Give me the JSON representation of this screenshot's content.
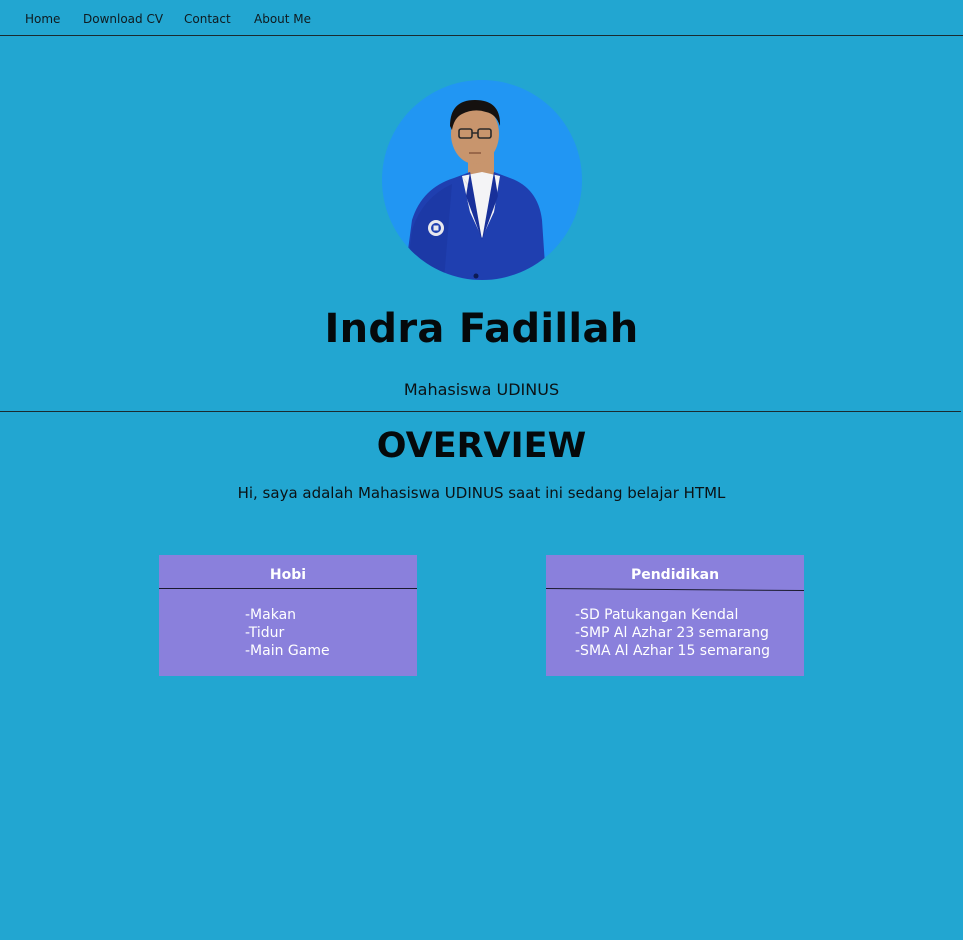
{
  "nav": {
    "items": [
      {
        "label": "Home"
      },
      {
        "label": "Download CV"
      },
      {
        "label": "Contact"
      },
      {
        "label": "About Me"
      }
    ]
  },
  "profile": {
    "name": "Indra Fadillah",
    "subtitle": "Mahasiswa UDINUS",
    "avatar_bg": "#2196f3"
  },
  "overview": {
    "title": "OVERVIEW",
    "text": "Hi, saya adalah Mahasiswa UDINUS saat ini sedang belajar HTML"
  },
  "cards": {
    "hobi": {
      "title": "Hobi",
      "items": [
        "-Makan",
        "-Tidur",
        "-Main Game"
      ]
    },
    "pendidikan": {
      "title": "Pendidikan",
      "items": [
        "-SD Patukangan Kendal",
        "-SMP Al Azhar 23 semarang",
        "-SMA Al Azhar 15 semarang"
      ]
    }
  },
  "colors": {
    "background": "#22a6d1",
    "card": "#8a80dc",
    "text": "#0b1012"
  }
}
